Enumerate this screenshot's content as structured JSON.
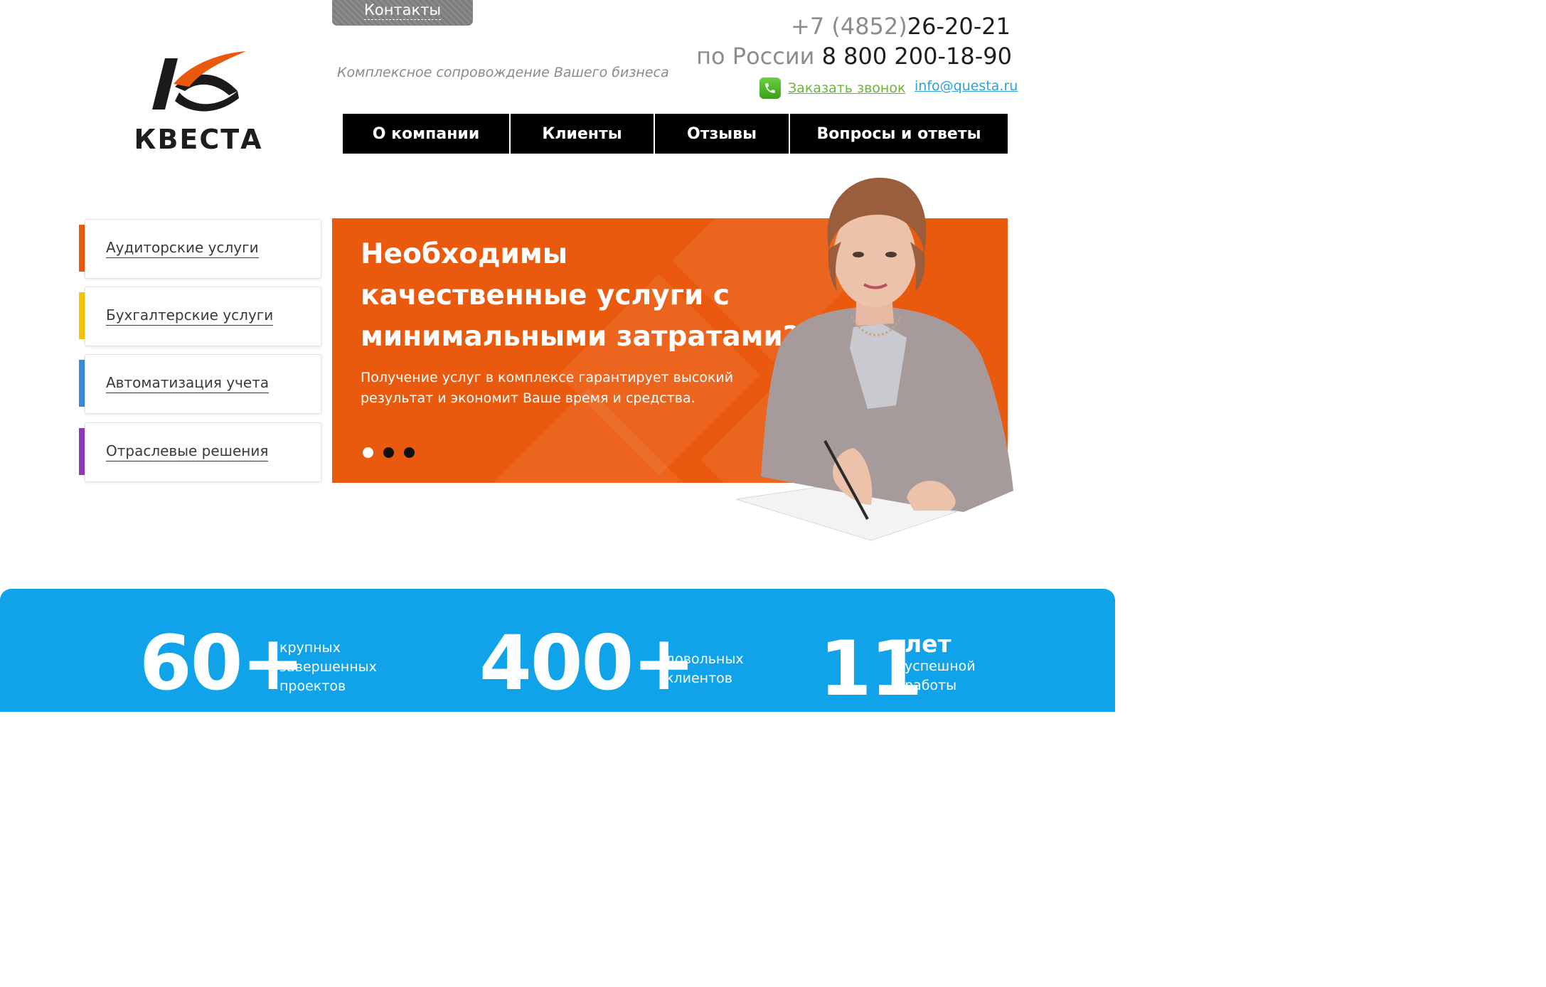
{
  "header": {
    "contacts_tab": "Контакты",
    "logo_text": "КВЕСТА",
    "tagline": "Комплексное сопровождение Вашего бизнеса",
    "phone_local_code": "+7 (4852)",
    "phone_local_number": "26-20-21",
    "phone_russia_prefix": "по России",
    "phone_russia_number": "8 800 200-18-90",
    "callback_label": "Заказать звонок",
    "email": "info@questa.ru"
  },
  "nav": {
    "items": [
      {
        "label": "О компании"
      },
      {
        "label": "Клиенты"
      },
      {
        "label": "Отзывы"
      },
      {
        "label": "Вопросы и ответы"
      }
    ]
  },
  "services": {
    "items": [
      {
        "label": "Аудиторские услуги",
        "color": "#ea5a0e"
      },
      {
        "label": "Бухгалтерские услуги",
        "color": "#f5c400"
      },
      {
        "label": "Автоматизация учета",
        "color": "#3b8ad8"
      },
      {
        "label": "Отраслевые решения",
        "color": "#8e3ab8"
      }
    ]
  },
  "banner": {
    "title": "Необходимы качественные услуги с минимальными затратами?",
    "subtitle": "Получение услуг в комплексе гарантирует высокий результат и экономит Ваше время и средства.",
    "slides_total": 3,
    "active_slide": 1,
    "background_color": "#ea5a0e"
  },
  "stats": {
    "background_color": "#10a3e9",
    "items": [
      {
        "number": "60+",
        "line1": "крупных",
        "line2": "завершенных",
        "line3": "проектов"
      },
      {
        "number": "400+",
        "line1": "довольных",
        "line2": "клиентов"
      },
      {
        "number": "11",
        "line1": "лет",
        "line2": "успешной",
        "line3": "работы"
      }
    ]
  }
}
